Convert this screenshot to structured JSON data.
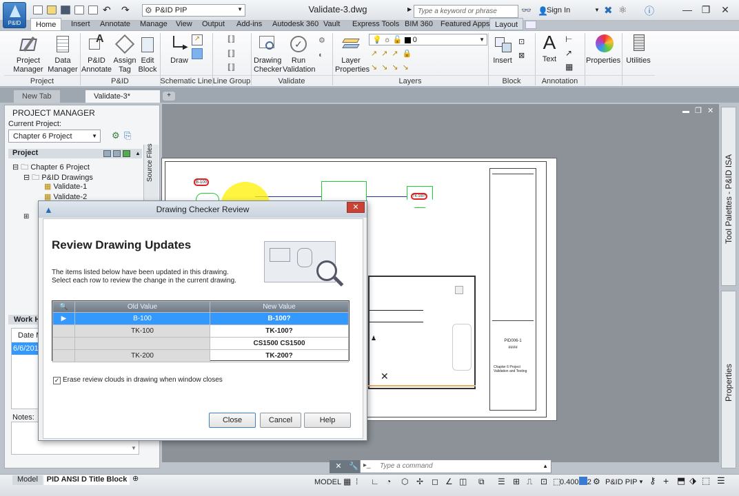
{
  "app": {
    "logo_label": "P&ID",
    "workspace": "P&ID PIP",
    "doc_title": "Validate-3.dwg"
  },
  "search": {
    "placeholder": "Type a keyword or phrase"
  },
  "signin": "Sign In",
  "ribbon_tabs": [
    "Home",
    "Insert",
    "Annotate",
    "Manage",
    "View",
    "Output",
    "Add-ins",
    "Autodesk 360",
    "Vault",
    "Express Tools",
    "BIM 360",
    "Featured Apps",
    "Layout"
  ],
  "ribbon": {
    "project_manager": "Project\nManager",
    "data_manager": "Data\nManager",
    "pid_annotate": "P&ID\nAnnotate",
    "assign_tag": "Assign\nTag",
    "edit_block": "Edit\nBlock",
    "draw": "Draw",
    "drawing_checker": "Drawing\nChecker",
    "run_validation": "Run\nValidation",
    "layer_properties": "Layer\nProperties",
    "layer_value": "0",
    "insert": "Insert",
    "text": "Text",
    "properties": "Properties",
    "utilities": "Utilities",
    "panels": [
      "Project",
      "P&ID",
      "Schematic Line",
      "Line Group",
      "Validate",
      "Layers",
      "Block",
      "Annotation"
    ]
  },
  "file_tabs": {
    "new_tab": "New Tab",
    "current": "Validate-3*"
  },
  "project_manager": {
    "title": "PROJECT MANAGER",
    "current_project_label": "Current Project:",
    "current_project": "Chapter 6 Project",
    "section": "Project",
    "source_files": "Source Files",
    "tree": [
      "Chapter 6 Project",
      "P&ID Drawings",
      "Validate-1",
      "Validate-2"
    ],
    "work_history": "Work Hi",
    "date_col": "Date M",
    "date_val": "6/6/201",
    "notes": "Notes:"
  },
  "palettes": {
    "tool": "Tool Palettes - P&ID ISA",
    "props": "Properties"
  },
  "drawing": {
    "tag1": "B-100",
    "tag2": "TK-100?",
    "sheet_no": "PID006-1",
    "sheet_val": "####",
    "title_block": "Chapter 6 Project Validation and Testing"
  },
  "dialog": {
    "title": "Drawing Checker Review",
    "heading": "Review Drawing Updates",
    "desc1": "The items listed below have been updated in this drawing.",
    "desc2": "Select each row to review the change in the current drawing.",
    "col_old": "Old Value",
    "col_new": "New Value",
    "rows": [
      {
        "old": "B-100",
        "new": "B-100?"
      },
      {
        "old": "TK-100",
        "new": "TK-100?"
      },
      {
        "old": "",
        "new": "CS1500  CS1500"
      },
      {
        "old": "TK-200",
        "new": "TK-200?"
      }
    ],
    "erase_label": "Erase review clouds in drawing when window closes",
    "close": "Close",
    "cancel": "Cancel",
    "help": "Help"
  },
  "cmd": {
    "placeholder": "Type a command"
  },
  "layout_tabs": [
    "Model",
    "PID ANSI D Title Block"
  ],
  "status": {
    "model": "MODEL",
    "scale": "0.400932",
    "workspace": "P&ID PIP"
  }
}
